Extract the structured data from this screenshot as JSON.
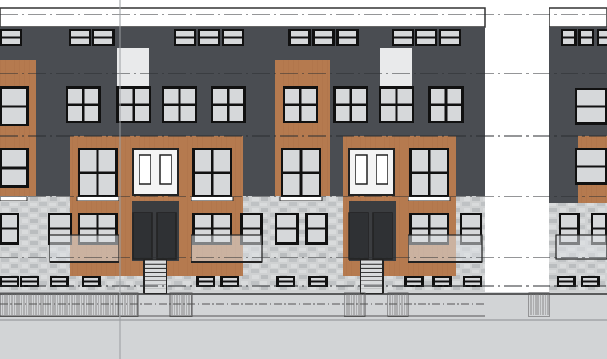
{
  "drawing": {
    "kind": "front-elevation",
    "subject": "townhouse-block",
    "storeys": 4,
    "units_visible": 6,
    "doors_visible": 4,
    "entry_stairs": 2,
    "level_datum_lines": 6
  },
  "materials": {
    "dark_cladding": "#4a4d52",
    "wood_cladding": "#b57a4f",
    "stone_base": "#c9cbcc",
    "window_frame": "#111111",
    "window_glass": "#d6d8da",
    "door_panel": "#f4f4f4",
    "ground": "#d2d4d6",
    "line_work": "#222222"
  },
  "icons": [
    "window-icon",
    "door-icon",
    "stair-icon",
    "fence-icon"
  ]
}
